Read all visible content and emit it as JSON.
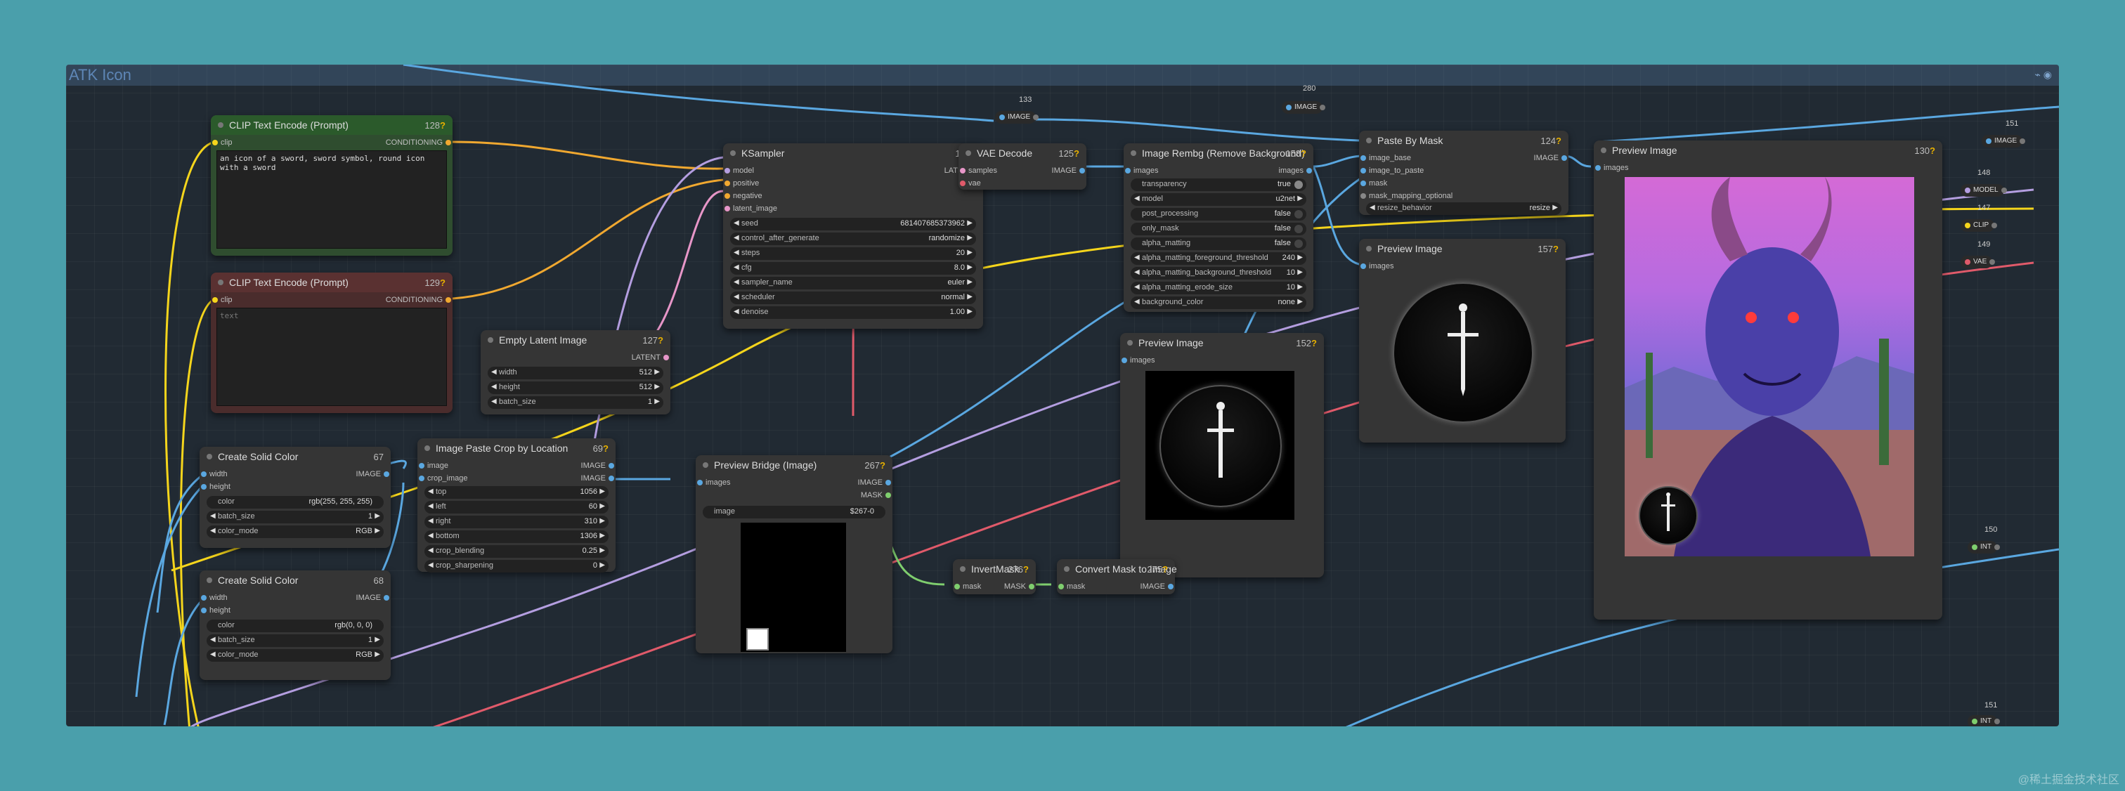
{
  "group_title": "ATK Icon",
  "colors": {
    "background": "#4a9fab",
    "canvas": "#212a33",
    "image_wire": "#5aa7e0",
    "conditioning_wire": "#f0a830",
    "clip_wire": "#f5d51c",
    "latent_wire": "#e796c8",
    "vae_wire": "#e05a6a",
    "mask_wire": "#7fce6e",
    "model_wire": "#b49ee0"
  },
  "nodes": {
    "clip_pos": {
      "title": "CLIP Text Encode (Prompt)",
      "id": "128",
      "in_clip": "clip",
      "out": "CONDITIONING",
      "text": "an icon of a sword, sword symbol, round icon with a sword"
    },
    "clip_neg": {
      "title": "CLIP Text Encode (Prompt)",
      "id": "129",
      "in_clip": "clip",
      "out": "CONDITIONING",
      "placeholder": "text"
    },
    "ksampler": {
      "title": "KSampler",
      "id": "134",
      "inputs": [
        "model",
        "positive",
        "negative",
        "latent_image"
      ],
      "out": "LATENT",
      "widgets": [
        {
          "label": "seed",
          "value": "681407685373962"
        },
        {
          "label": "control_after_generate",
          "value": "randomize"
        },
        {
          "label": "steps",
          "value": "20"
        },
        {
          "label": "cfg",
          "value": "8.0"
        },
        {
          "label": "sampler_name",
          "value": "euler"
        },
        {
          "label": "scheduler",
          "value": "normal"
        },
        {
          "label": "denoise",
          "value": "1.00"
        }
      ]
    },
    "vae_decode": {
      "title": "VAE Decode",
      "id": "125",
      "inputs": [
        "samples",
        "vae"
      ],
      "out": "IMAGE"
    },
    "rembg": {
      "title": "Image Rembg (Remove Background)",
      "id": "158",
      "in": "images",
      "out": "images",
      "widgets": [
        {
          "label": "transparency",
          "value": "true"
        },
        {
          "label": "model",
          "value": "u2net"
        },
        {
          "label": "post_processing",
          "value": "false"
        },
        {
          "label": "only_mask",
          "value": "false"
        },
        {
          "label": "alpha_matting",
          "value": "false"
        },
        {
          "label": "alpha_matting_foreground_threshold",
          "value": "240"
        },
        {
          "label": "alpha_matting_background_threshold",
          "value": "10"
        },
        {
          "label": "alpha_matting_erode_size",
          "value": "10"
        },
        {
          "label": "background_color",
          "value": "none"
        }
      ]
    },
    "paste_mask": {
      "title": "Paste By Mask",
      "id": "124",
      "inputs": [
        "image_base",
        "image_to_paste",
        "mask",
        "mask_mapping_optional"
      ],
      "out": "IMAGE",
      "widgets": [
        {
          "label": "resize_behavior",
          "value": "resize"
        }
      ]
    },
    "preview_main": {
      "title": "Preview Image",
      "id": "130",
      "in": "images"
    },
    "preview_157": {
      "title": "Preview Image",
      "id": "157",
      "in": "images"
    },
    "preview_152": {
      "title": "Preview Image",
      "id": "152",
      "in": "images"
    },
    "empty_latent": {
      "title": "Empty Latent Image",
      "id": "127",
      "out": "LATENT",
      "widgets": [
        {
          "label": "width",
          "value": "512"
        },
        {
          "label": "height",
          "value": "512"
        },
        {
          "label": "batch_size",
          "value": "1"
        }
      ]
    },
    "solid_67": {
      "title": "Create Solid Color",
      "id": "67",
      "inputs": [
        "width",
        "height"
      ],
      "out": "IMAGE",
      "widgets": [
        {
          "label": "color",
          "value": "rgb(255, 255, 255)"
        },
        {
          "label": "batch_size",
          "value": "1"
        },
        {
          "label": "color_mode",
          "value": "RGB"
        }
      ]
    },
    "solid_68": {
      "title": "Create Solid Color",
      "id": "68",
      "inputs": [
        "width",
        "height"
      ],
      "out": "IMAGE",
      "widgets": [
        {
          "label": "color",
          "value": "rgb(0, 0, 0)"
        },
        {
          "label": "batch_size",
          "value": "1"
        },
        {
          "label": "color_mode",
          "value": "RGB"
        }
      ]
    },
    "paste_crop": {
      "title": "Image Paste Crop by Location",
      "id": "69",
      "inputs": [
        "image",
        "crop_image"
      ],
      "outs": [
        "IMAGE",
        "IMAGE"
      ],
      "widgets": [
        {
          "label": "top",
          "value": "1056"
        },
        {
          "label": "left",
          "value": "60"
        },
        {
          "label": "right",
          "value": "310"
        },
        {
          "label": "bottom",
          "value": "1306"
        },
        {
          "label": "crop_blending",
          "value": "0.25"
        },
        {
          "label": "crop_sharpening",
          "value": "0"
        }
      ]
    },
    "preview_bridge": {
      "title": "Preview Bridge (Image)",
      "id": "267",
      "in": "images",
      "outs": [
        "IMAGE",
        "MASK"
      ],
      "widgets": [
        {
          "label": "image",
          "value": "$267-0"
        }
      ]
    },
    "invert_mask": {
      "title": "InvertMask",
      "id": "276",
      "in": "mask",
      "out": "MASK"
    },
    "convert_mask": {
      "title": "Convert Mask to Image",
      "id": "275",
      "in": "mask",
      "out": "IMAGE"
    }
  },
  "reroutes": [
    {
      "id": "133",
      "label": "IMAGE"
    },
    {
      "id": "280",
      "label": "IMAGE"
    },
    {
      "id": "151",
      "label": "IMAGE"
    },
    {
      "id": "148",
      "label": "MODEL"
    },
    {
      "id": "147",
      "label": "CLIP"
    },
    {
      "id": "149",
      "label": "VAE"
    },
    {
      "id": "150",
      "label": "INT"
    },
    {
      "id": "151",
      "label": "INT"
    }
  ],
  "watermark": "@稀土掘金技术社区"
}
